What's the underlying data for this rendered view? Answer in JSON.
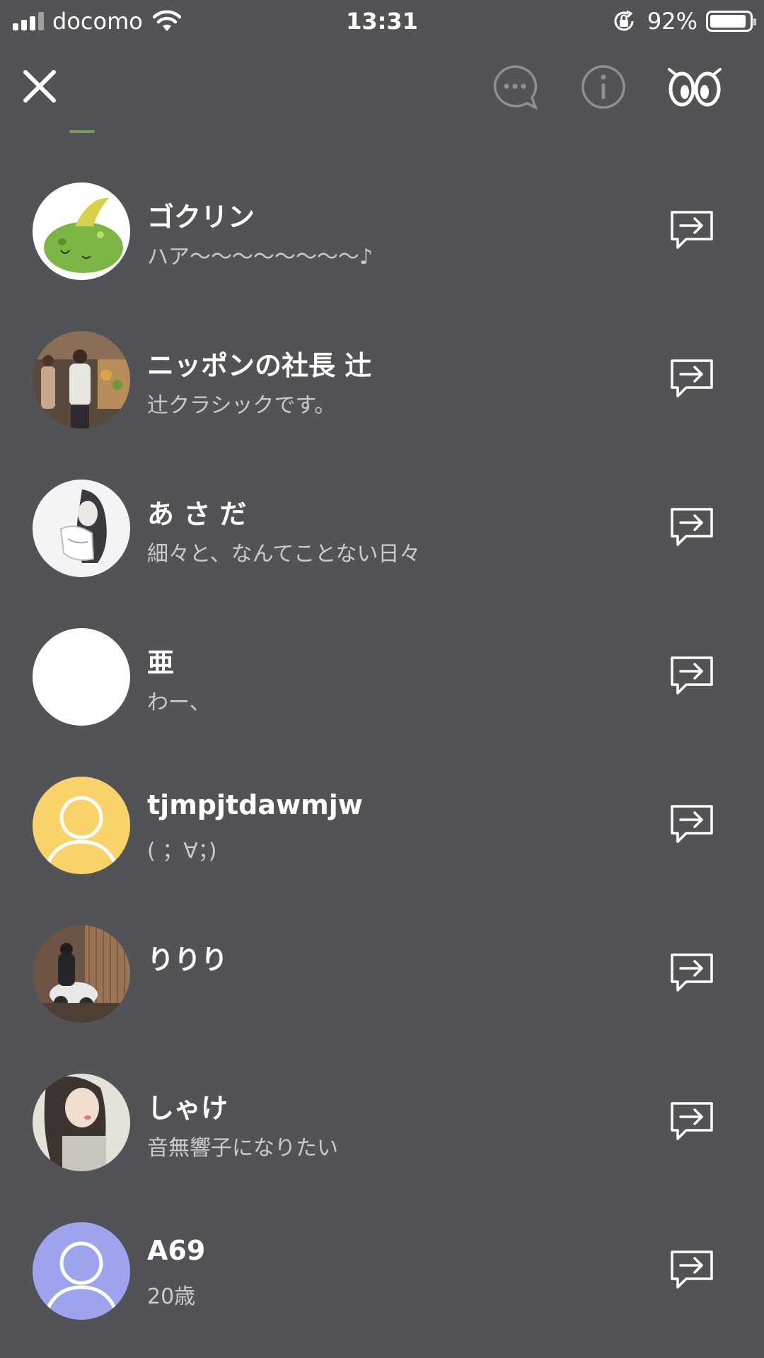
{
  "status_bar": {
    "carrier": "docomo",
    "time": "13:31",
    "battery_percent": "92%",
    "battery_level": 0.92,
    "signal_bars": 3
  },
  "top_bar": {
    "icons": [
      "close-icon",
      "chat-icon",
      "info-icon",
      "eyes-icon"
    ]
  },
  "colors": {
    "background": "#515357",
    "status_text": "#c9cbce",
    "avatar_yellow": "#f9d36a",
    "avatar_lavender": "#9ea3ee"
  },
  "friends": [
    {
      "name": "ゴクリン",
      "status": "ハア〜〜〜〜〜〜〜〜♪",
      "avatar": "green-blob-avatar"
    },
    {
      "name": "ニッポンの社長 辻",
      "status": "辻クラシックです。",
      "avatar": "photo-avatar"
    },
    {
      "name": "あ さ だ",
      "status": "細々と、なんてことない日々",
      "avatar": "illustration-avatar"
    },
    {
      "name": "亜",
      "status": "わー、",
      "avatar": "blank-avatar"
    },
    {
      "name": "tjmpjtdawmjw",
      "status": "( ；∀；)",
      "avatar": "default-yellow-avatar"
    },
    {
      "name": "りりり",
      "status": "",
      "avatar": "photo-avatar"
    },
    {
      "name": "しゃけ",
      "status": "音無響子になりたい",
      "avatar": "photo-avatar"
    },
    {
      "name": "A69",
      "status": "20歳",
      "avatar": "default-lavender-avatar"
    }
  ]
}
